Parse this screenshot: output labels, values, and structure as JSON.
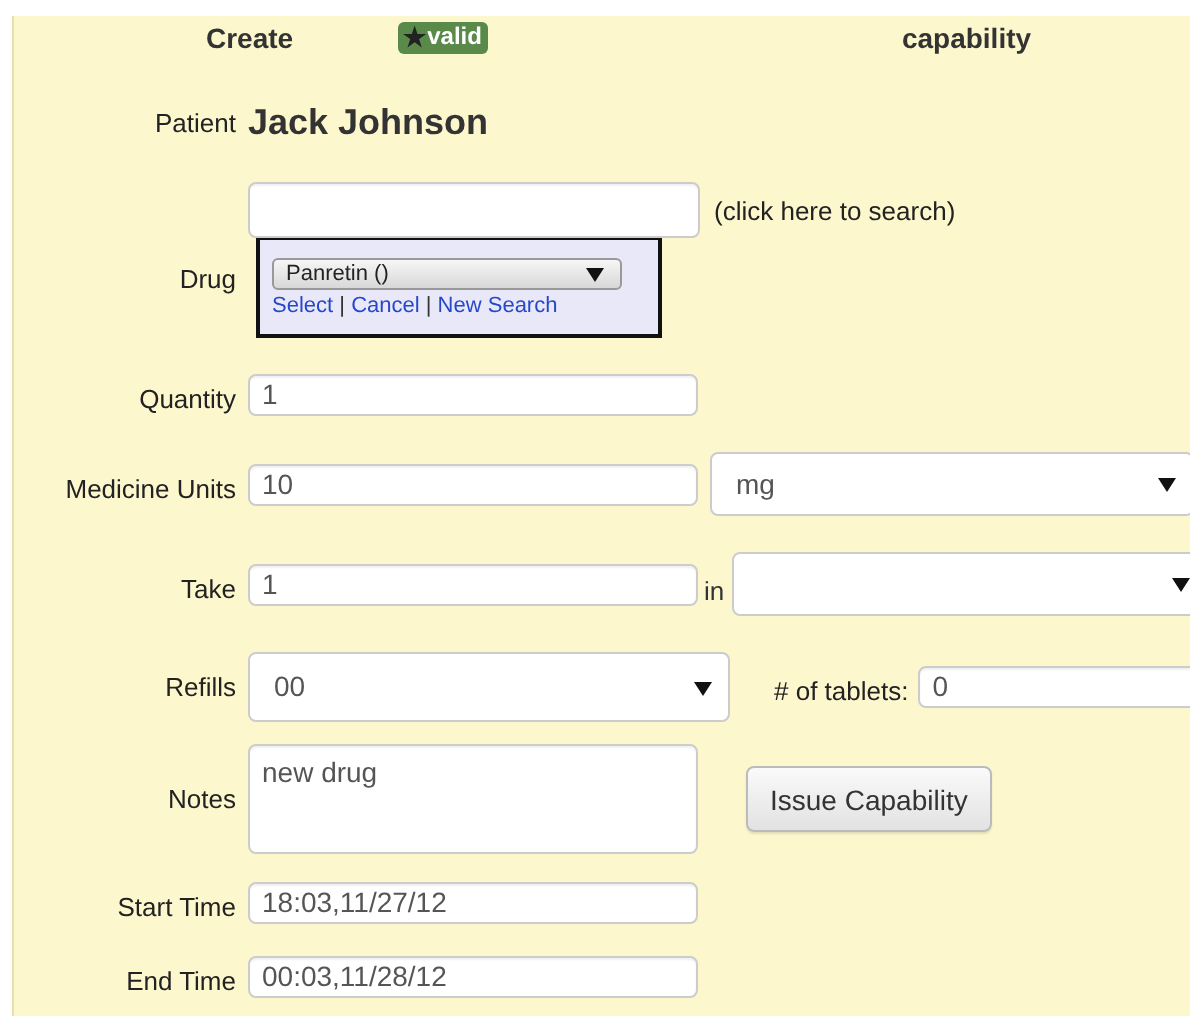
{
  "header": {
    "title_left": "Create",
    "badge": {
      "icon": "★",
      "label": "valid"
    },
    "title_right": "capability"
  },
  "patient": {
    "label": "Patient",
    "name": "Jack Johnson"
  },
  "drug": {
    "label": "Drug",
    "hint": "(click here to search)",
    "popup": {
      "select": "Panretin ()",
      "links": [
        "Select",
        "Cancel",
        "New Search"
      ],
      "separator": "|"
    }
  },
  "fields": [
    {
      "kind": "text",
      "label": "Quantity",
      "value": "1"
    },
    {
      "kind": "text_select",
      "label": "Medicine Units",
      "value": "10",
      "select": "mg"
    },
    {
      "kind": "text_in_select",
      "label": "Take",
      "value": "1",
      "joiner": "in"
    },
    {
      "kind": "select_extra",
      "label": "Refills",
      "select": "00",
      "extra_label": "# of tablets:",
      "extra_value": "0"
    },
    {
      "kind": "textarea",
      "label": "Notes",
      "value": "new drug",
      "button": "Issue Capability"
    },
    {
      "kind": "text",
      "label": "Start Time",
      "value": "18:03,11/27/12"
    },
    {
      "kind": "text",
      "label": "End Time",
      "value": "00:03,11/28/12"
    }
  ]
}
